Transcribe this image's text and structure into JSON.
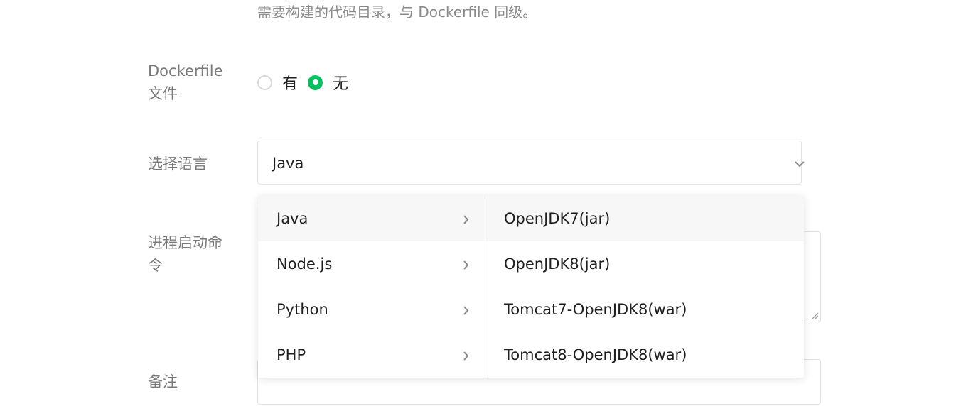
{
  "form": {
    "context_hint": "需要构建的代码目录，与 Dockerfile 同级。",
    "dockerfile": {
      "label_line1": "Dockerfile",
      "label_line2": "文件",
      "options": [
        {
          "label": "有",
          "checked": false
        },
        {
          "label": "无",
          "checked": true
        }
      ]
    },
    "language": {
      "label": "选择语言",
      "selected": "Java"
    },
    "start_command": {
      "label_line1": "进程启动命",
      "label_line2": "令"
    },
    "remark": {
      "label": "备注"
    }
  },
  "cascader": {
    "languages": [
      "Java",
      "Node.js",
      "Python",
      "PHP"
    ],
    "active_language": "Java",
    "runtimes": [
      "OpenJDK7(jar)",
      "OpenJDK8(jar)",
      "Tomcat7-OpenJDK8(war)",
      "Tomcat8-OpenJDK8(war)"
    ],
    "active_runtime": "OpenJDK7(jar)"
  },
  "colors": {
    "accent": "#07c160",
    "label": "#7a7a7a",
    "border": "#e2e2e2"
  },
  "icons": [
    "chevron-down-icon",
    "chevron-right-icon",
    "resize-handle-icon"
  ]
}
